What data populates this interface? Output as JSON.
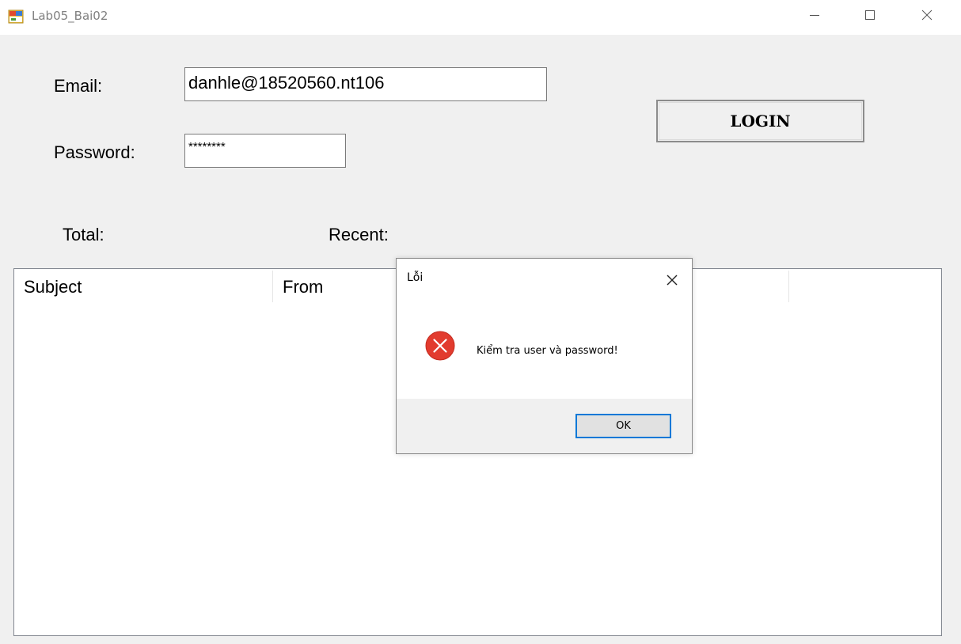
{
  "window": {
    "title": "Lab05_Bai02",
    "icon": "windows-form-icon",
    "controls": [
      "minimize-icon",
      "maximize-icon",
      "close-icon"
    ]
  },
  "form": {
    "email_label": "Email:",
    "email_value": "danhle@18520560.nt106",
    "password_label": "Password:",
    "password_value": "********",
    "login_label": "LOGIN",
    "total_label": "Total:",
    "recent_label": "Recent:"
  },
  "listview": {
    "columns": [
      "Subject",
      "From",
      ""
    ]
  },
  "dialog": {
    "title": "Lỗi",
    "message": "Kiểm tra user và password!",
    "ok_label": "OK",
    "icon": "error-icon",
    "accent_color": "#0078d7",
    "error_color": "#e81123"
  }
}
